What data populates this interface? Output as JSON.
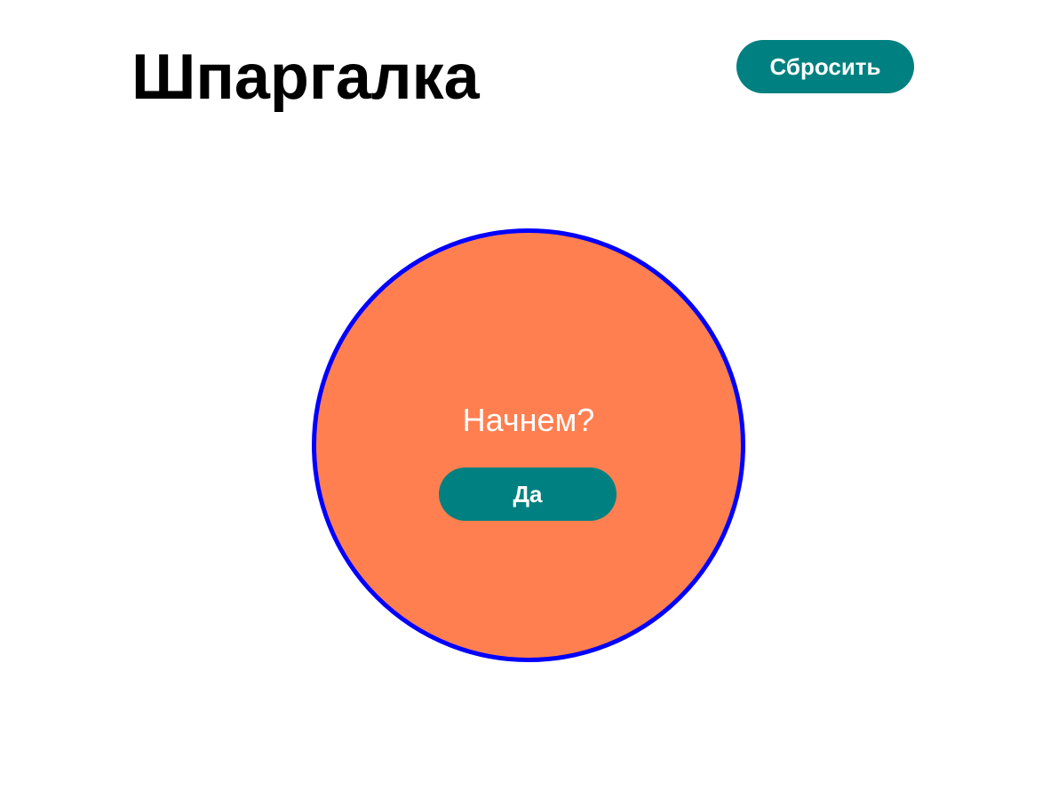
{
  "header": {
    "title": "Шпаргалка",
    "reset_label": "Сбросить"
  },
  "card": {
    "prompt": "Начнем?",
    "yes_label": "Да"
  },
  "colors": {
    "accent": "#008080",
    "circle_fill": "#ff7f50",
    "circle_border": "#0000ff",
    "text_dark": "#000000",
    "text_light": "#ffffff",
    "background": "#ffffff"
  }
}
